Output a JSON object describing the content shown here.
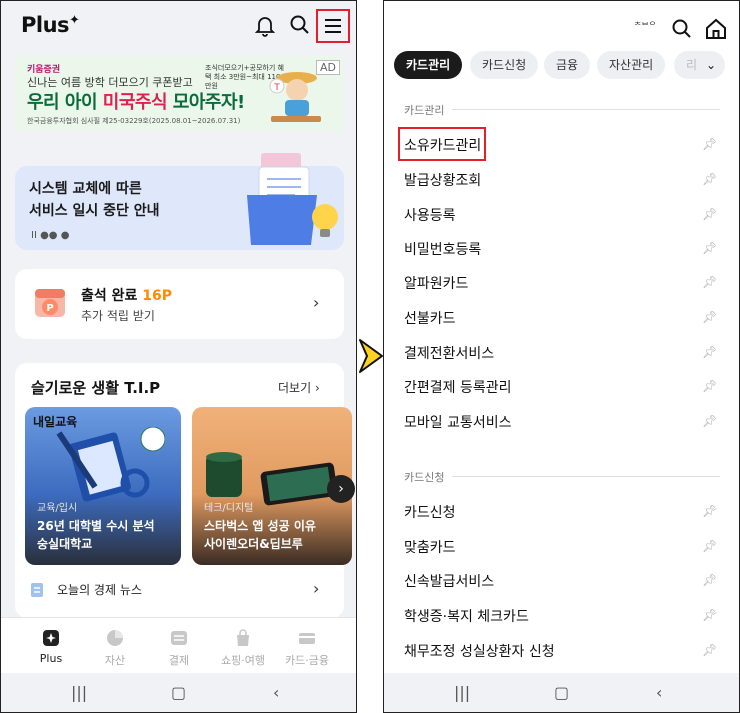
{
  "left": {
    "logo": "Plus",
    "ad": {
      "tag": "AD",
      "brand": "키움증권",
      "sub": "신나는 여름 방학 더모으기 쿠폰받고",
      "main_a": "우리 아이 ",
      "main_hl": "미국주식",
      "main_b": " 모아주자!",
      "note": "조식더모으기+공모하기 혜택 최소 3만원~최대 110만원",
      "fine": "한국금융투자협회 심사필 제25-03229호(2025.08.01~2026.07.31)"
    },
    "banner": {
      "line1": "시스템 교체에 따른",
      "line2": "서비스 일시 중단 안내",
      "pager": "II ●● ●"
    },
    "attendance": {
      "title": "출석 완료",
      "points": "16P",
      "subtitle": "추가 적립 받기"
    },
    "tip": {
      "title": "슬기로운 생활 T.I.P",
      "more": "더보기",
      "cards": [
        {
          "brand": "내일교육",
          "category": "교육/입시",
          "line1": "26년 대학별 수시 분석",
          "line2": "숭실대학교"
        },
        {
          "brand": "",
          "category": "테크/디지털",
          "line1": "스타벅스 앱 성공 이유",
          "line2": "사이렌오더&딥브루"
        }
      ],
      "news": "오늘의 경제 뉴스"
    },
    "tabs": [
      {
        "label": "Plus",
        "active": true
      },
      {
        "label": "자산",
        "active": false
      },
      {
        "label": "결제",
        "active": false
      },
      {
        "label": "쇼핑·여행",
        "active": false
      },
      {
        "label": "카드·금융",
        "active": false
      }
    ]
  },
  "right": {
    "header_text": "ᄎᄇᄋ",
    "chips": [
      {
        "label": "카드관리",
        "active": true
      },
      {
        "label": "카드신청",
        "active": false
      },
      {
        "label": "금융",
        "active": false
      },
      {
        "label": "자산관리",
        "active": false
      },
      {
        "label": "리조",
        "active": false
      }
    ],
    "sections": [
      {
        "title": "카드관리",
        "items": [
          "소유카드관리",
          "발급상황조회",
          "사용등록",
          "비밀번호등록",
          "알파원카드",
          "선불카드",
          "결제전환서비스",
          "간편결제 등록관리",
          "모바일 교통서비스"
        ]
      },
      {
        "title": "카드신청",
        "items": [
          "카드신청",
          "맞춤카드",
          "신속발급서비스",
          "학생증·복지 체크카드",
          "채무조정 성실상환자 신청"
        ]
      }
    ]
  }
}
